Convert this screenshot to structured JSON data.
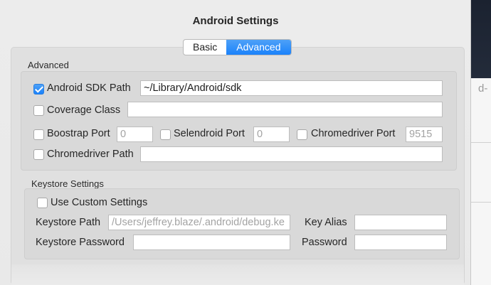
{
  "dialog": {
    "title": "Android Settings",
    "tabs": [
      {
        "label": "Basic",
        "active": false
      },
      {
        "label": "Advanced",
        "active": true
      }
    ]
  },
  "advanced": {
    "section_label": "Advanced",
    "sdk_path": {
      "label": "Android SDK Path",
      "checked": true,
      "value": "~/Library/Android/sdk"
    },
    "coverage_class": {
      "label": "Coverage Class",
      "checked": false,
      "value": ""
    },
    "bootstrap_port": {
      "label": "Boostrap Port",
      "checked": false,
      "placeholder": "0"
    },
    "selendroid_port": {
      "label": "Selendroid Port",
      "checked": false,
      "placeholder": "0"
    },
    "chromedriver_port": {
      "label": "Chromedriver Port",
      "checked": false,
      "placeholder": "9515"
    },
    "chromedriver_path": {
      "label": "Chromedriver Path",
      "checked": false,
      "value": ""
    }
  },
  "keystore": {
    "section_label": "Keystore Settings",
    "use_custom": {
      "label": "Use Custom Settings",
      "checked": false
    },
    "path": {
      "label": "Keystore Path",
      "placeholder": "/Users/jeffrey.blaze/.android/debug.ke"
    },
    "key_alias": {
      "label": "Key Alias",
      "value": ""
    },
    "password": {
      "label": "Keystore Password",
      "value": ""
    },
    "key_password": {
      "label": "Password",
      "value": ""
    }
  },
  "background": {
    "partial_text": "d-"
  },
  "colors": {
    "accent": "#1a82fb",
    "dialog_bg": "#ececec"
  }
}
